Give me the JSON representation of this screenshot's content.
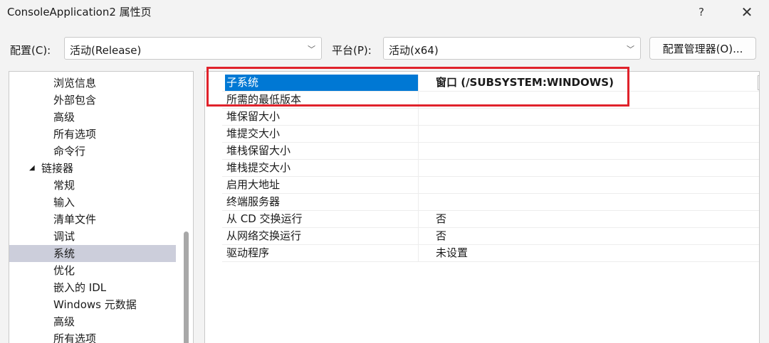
{
  "window": {
    "title": "ConsoleApplication2 属性页",
    "help_label": "?",
    "close_label": "✕"
  },
  "config_bar": {
    "config_label": "配置(C):",
    "config_value": "活动(Release)",
    "platform_label": "平台(P):",
    "platform_value": "活动(x64)",
    "manager_button": "配置管理器(O)...",
    "dropdown_glyph": "﹀"
  },
  "tree": {
    "items": [
      {
        "label": "浏览信息",
        "group": false,
        "selected": false
      },
      {
        "label": "外部包含",
        "group": false,
        "selected": false
      },
      {
        "label": "高级",
        "group": false,
        "selected": false
      },
      {
        "label": "所有选项",
        "group": false,
        "selected": false
      },
      {
        "label": "命令行",
        "group": false,
        "selected": false
      },
      {
        "label": "链接器",
        "group": true,
        "selected": false,
        "caret": "◢"
      },
      {
        "label": "常规",
        "group": false,
        "selected": false
      },
      {
        "label": "输入",
        "group": false,
        "selected": false
      },
      {
        "label": "清单文件",
        "group": false,
        "selected": false
      },
      {
        "label": "调试",
        "group": false,
        "selected": false
      },
      {
        "label": "系统",
        "group": false,
        "selected": true
      },
      {
        "label": "优化",
        "group": false,
        "selected": false
      },
      {
        "label": "嵌入的 IDL",
        "group": false,
        "selected": false
      },
      {
        "label": "Windows 元数据",
        "group": false,
        "selected": false
      },
      {
        "label": "高级",
        "group": false,
        "selected": false
      },
      {
        "label": "所有选项",
        "group": false,
        "selected": false
      }
    ]
  },
  "properties": {
    "rows": [
      {
        "name": "子系统",
        "value": "窗口 (/SUBSYSTEM:WINDOWS)",
        "selected": true
      },
      {
        "name": "所需的最低版本",
        "value": "",
        "selected": false
      },
      {
        "name": "堆保留大小",
        "value": "",
        "selected": false
      },
      {
        "name": "堆提交大小",
        "value": "",
        "selected": false
      },
      {
        "name": "堆栈保留大小",
        "value": "",
        "selected": false
      },
      {
        "name": "堆栈提交大小",
        "value": "",
        "selected": false
      },
      {
        "name": "启用大地址",
        "value": "",
        "selected": false
      },
      {
        "name": "终端服务器",
        "value": "",
        "selected": false
      },
      {
        "name": "从 CD 交换运行",
        "value": "否",
        "selected": false
      },
      {
        "name": "从网络交换运行",
        "value": "否",
        "selected": false
      },
      {
        "name": "驱动程序",
        "value": "未设置",
        "selected": false
      }
    ]
  },
  "colors": {
    "selection_blue": "#0078d4",
    "tree_selection": "#cccedb",
    "highlight_red": "#e0222b"
  }
}
